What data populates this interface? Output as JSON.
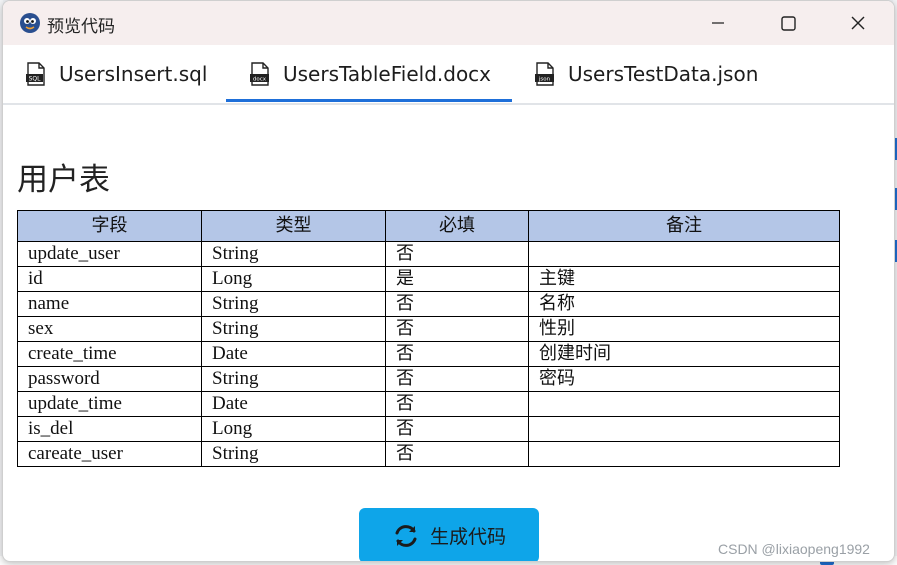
{
  "window": {
    "title": "预览代码"
  },
  "tabs": [
    {
      "label": "UsersInsert.sql",
      "icon": "sql-file-icon",
      "active": false
    },
    {
      "label": "UsersTableField.docx",
      "icon": "docx-file-icon",
      "active": true
    },
    {
      "label": "UsersTestData.json",
      "icon": "json-file-icon",
      "active": false
    }
  ],
  "document": {
    "heading": "用户表",
    "table": {
      "headers": [
        "字段",
        "类型",
        "必填",
        "备注"
      ],
      "rows": [
        [
          "update_user",
          "String",
          "否",
          ""
        ],
        [
          "id",
          "Long",
          "是",
          "主键"
        ],
        [
          "name",
          "String",
          "否",
          "名称"
        ],
        [
          "sex",
          "String",
          "否",
          "性别"
        ],
        [
          "create_time",
          "Date",
          "否",
          "创建时间"
        ],
        [
          "password",
          "String",
          "否",
          "密码"
        ],
        [
          "update_time",
          "Date",
          "否",
          ""
        ],
        [
          "is_del",
          "Long",
          "否",
          ""
        ],
        [
          "careate_user",
          "String",
          "否",
          ""
        ]
      ]
    }
  },
  "actions": {
    "generate_label": "生成代码"
  },
  "watermark": "CSDN @lixiaopeng1992",
  "colors": {
    "accent": "#1e6fd9",
    "button": "#0ea5e9",
    "table_header": "#b4c6e7",
    "titlebar": "#f6eeee"
  }
}
